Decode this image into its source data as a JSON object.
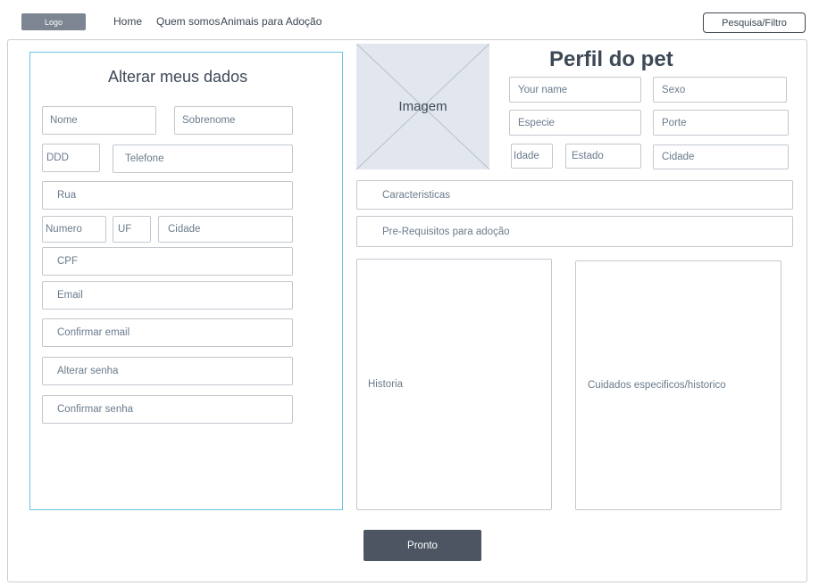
{
  "header": {
    "logo": "Logo",
    "nav": [
      "Home",
      "Quem somos",
      "Animais para Adoção"
    ],
    "search_button": "Pesquisa/Filtro"
  },
  "form": {
    "title": "Alterar meus dados",
    "nome": "Nome",
    "sobrenome": "Sobrenome",
    "ddd": "DDD",
    "telefone": "Telefone",
    "rua": "Rua",
    "numero": "Numero",
    "uf": "UF",
    "cidade": "Cidade",
    "cpf": "CPF",
    "email": "Email",
    "confirmar_email": "Confirmar email",
    "alterar_senha": "Alterar senha",
    "confirmar_senha": "Confirmar senha"
  },
  "pet": {
    "title": "Perfil do pet",
    "image_label": "Imagem",
    "your_name": "Your name",
    "sexo": "Sexo",
    "especie": "Especie",
    "porte": "Porte",
    "idade": "Idade",
    "estado": "Estado",
    "cidade": "Cidade",
    "caracteristicas": "Caracteristicas",
    "pre_requisitos": "Pre-Requisitos para adoção",
    "historia": "Historia",
    "cuidados": "Cuidados especificos/historico"
  },
  "actions": {
    "done": "Pronto"
  }
}
